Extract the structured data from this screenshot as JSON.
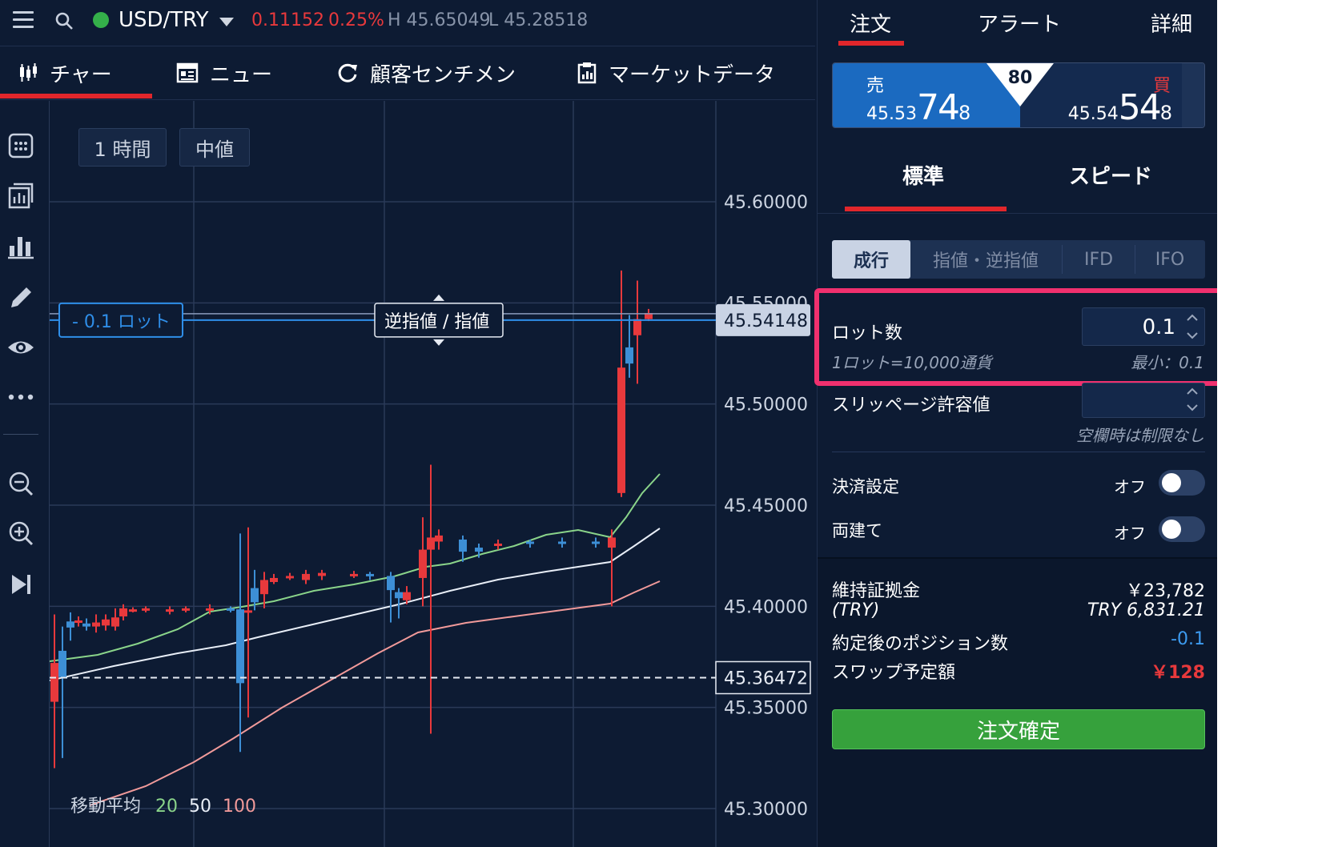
{
  "header": {
    "pair": "USD/TRY",
    "change": "0.11152",
    "change_pct": "0.25%",
    "high": "H 45.65049",
    "low": "L 45.28518",
    "connection_color": "#34b04a"
  },
  "tabs": [
    {
      "label": "チャー",
      "icon": "candlestick-icon"
    },
    {
      "label": "ニュー",
      "icon": "news-icon"
    },
    {
      "label": "顧客センチメン",
      "icon": "refresh-icon"
    },
    {
      "label": "マーケットデータ",
      "icon": "clipboard-icon"
    }
  ],
  "chart": {
    "interval": "1 時間",
    "price_type": "中値",
    "order_line_label": "- 0.1 ロット",
    "order_line_tag": "逆指値 / 指値",
    "current_price_tag": "45.54148",
    "reference_price_tag": "45.36472",
    "ma_label": "移動平均",
    "ma_periods": [
      "20",
      "50",
      "100"
    ],
    "ticks": [
      "45.60000",
      "45.55000",
      "45.50000",
      "45.45000",
      "45.40000",
      "45.35000",
      "45.30000"
    ]
  },
  "toolbar_icons": [
    "calculator-icon",
    "indicator-icon",
    "bar-chart-icon",
    "pencil-icon",
    "eye-icon",
    "more-icon",
    "zoom-out-icon",
    "zoom-in-icon",
    "skip-end-icon"
  ],
  "panel": {
    "tabs": [
      "注文",
      "アラート",
      "詳細"
    ],
    "sell": {
      "label": "売",
      "price_small": "45.53",
      "price_big": "74",
      "price_tail": "8"
    },
    "buy": {
      "label": "買",
      "price_small": "45.54",
      "price_big": "54",
      "price_tail": "8"
    },
    "spread": "80",
    "modes": [
      "標準",
      "スピード"
    ],
    "order_types": [
      "成行",
      "指値・逆指値",
      "IFD",
      "IFO"
    ],
    "lot": {
      "label": "ロット数",
      "value": "0.1",
      "note": "1ロット=10,000通貨",
      "min": "最小：0.1"
    },
    "slippage": {
      "label": "スリッページ許容値",
      "value": "",
      "note": "空欄時は制限なし"
    },
    "settle": {
      "label": "決済設定",
      "state": "オフ"
    },
    "hedge": {
      "label": "両建て",
      "state": "オフ"
    },
    "margin": {
      "label": "維持証拠金",
      "sub": "(TRY)",
      "value": "￥23,782",
      "value_try": "TRY 6,831.21"
    },
    "position": {
      "label": "約定後のポジション数",
      "value": "-0.1"
    },
    "swap": {
      "label": "スワップ予定額",
      "value": "￥128"
    },
    "confirm": "注文確定"
  },
  "colors": {
    "bg": "#0d1b33",
    "accent_red": "#e1262b",
    "up": "#e8393c",
    "down": "#3d8fd6",
    "confirm_green": "#36a13c",
    "highlight": "#f0306e"
  }
}
